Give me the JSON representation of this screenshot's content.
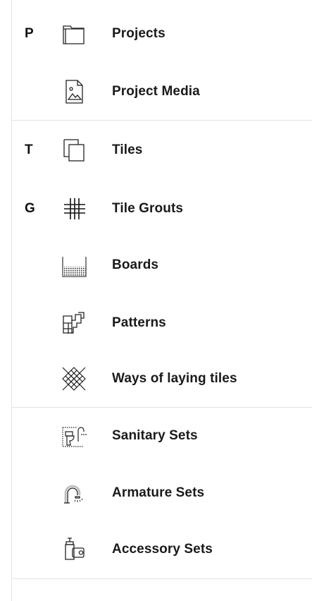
{
  "menu": {
    "items": [
      {
        "shortcut": "P",
        "label": "Projects",
        "icon": "folder-icon"
      },
      {
        "shortcut": "",
        "label": "Project Media",
        "icon": "image-file-icon"
      },
      {
        "shortcut": "T",
        "label": "Tiles",
        "icon": "tiles-stack-icon"
      },
      {
        "shortcut": "G",
        "label": "Tile Grouts",
        "icon": "grout-grid-icon"
      },
      {
        "shortcut": "",
        "label": "Boards",
        "icon": "board-icon"
      },
      {
        "shortcut": "",
        "label": "Patterns",
        "icon": "pattern-icon"
      },
      {
        "shortcut": "",
        "label": "Ways of laying tiles",
        "icon": "laying-crosshatch-icon"
      },
      {
        "shortcut": "",
        "label": "Sanitary Sets",
        "icon": "toilet-shower-icon"
      },
      {
        "shortcut": "",
        "label": "Armature Sets",
        "icon": "faucet-icon"
      },
      {
        "shortcut": "",
        "label": "Accessory Sets",
        "icon": "soap-dispenser-icon"
      }
    ]
  }
}
